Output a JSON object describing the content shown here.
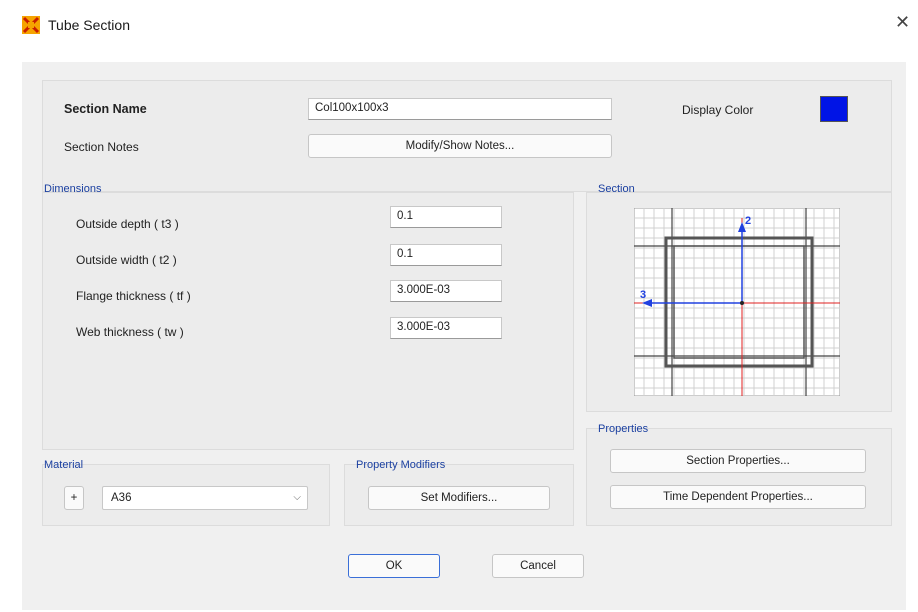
{
  "window": {
    "title": "Tube Section",
    "close_glyph": "✕"
  },
  "section_name": {
    "label": "Section Name",
    "value": "Col100x100x3"
  },
  "display_color": {
    "label": "Display Color",
    "color": "#0014e6"
  },
  "section_notes": {
    "label": "Section Notes",
    "button": "Modify/Show Notes..."
  },
  "dimensions": {
    "group_label": "Dimensions",
    "rows": [
      {
        "label": "Outside depth  ( t3 )",
        "value": "0.1"
      },
      {
        "label": "Outside width  ( t2 )",
        "value": "0.1"
      },
      {
        "label": "Flange thickness  ( tf )",
        "value": "3.000E-03"
      },
      {
        "label": "Web thickness  ( tw )",
        "value": "3.000E-03"
      }
    ]
  },
  "section_preview": {
    "group_label": "Section",
    "axis_2": "2",
    "axis_3": "3"
  },
  "properties": {
    "group_label": "Properties",
    "section_properties_button": "Section Properties...",
    "time_dependent_button": "Time Dependent Properties..."
  },
  "material": {
    "group_label": "Material",
    "add_button": "+",
    "selected": "A36"
  },
  "property_modifiers": {
    "group_label": "Property Modifiers",
    "button": "Set Modifiers..."
  },
  "footer": {
    "ok": "OK",
    "cancel": "Cancel"
  }
}
